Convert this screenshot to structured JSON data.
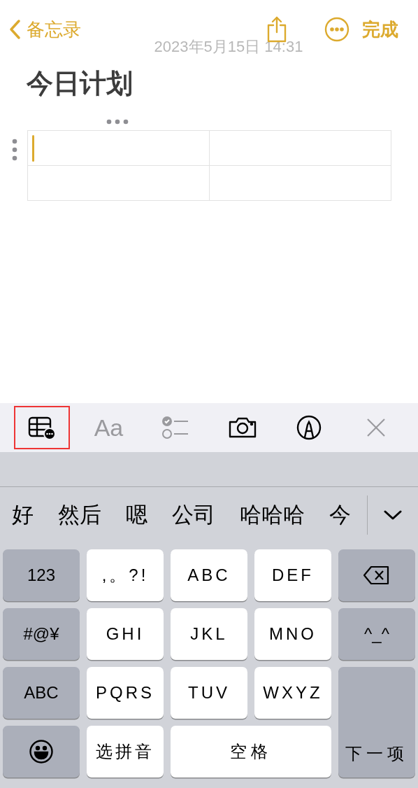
{
  "nav": {
    "back_label": "备忘录",
    "done_label": "完成"
  },
  "note": {
    "date": "2023年5月15日 14:31",
    "title": "今日计划",
    "table": {
      "rows": [
        [
          {
            "focused": true
          },
          {
            "focused": false
          }
        ],
        [
          {
            "focused": false
          },
          {
            "focused": false
          }
        ]
      ]
    }
  },
  "toolbar": [
    {
      "kind": "table",
      "disabled": false,
      "highlighted": true
    },
    {
      "kind": "format",
      "label": "Aa",
      "disabled": true,
      "highlighted": false
    },
    {
      "kind": "checklist",
      "disabled": true,
      "highlighted": false
    },
    {
      "kind": "camera",
      "disabled": false,
      "highlighted": false
    },
    {
      "kind": "markup",
      "disabled": false,
      "highlighted": false
    },
    {
      "kind": "close",
      "disabled": true,
      "highlighted": false
    }
  ],
  "candidates": [
    "好",
    "然后",
    "嗯",
    "公司",
    "哈哈哈",
    "今"
  ],
  "keys": [
    {
      "kind": "function",
      "label": "123"
    },
    {
      "kind": "letter",
      "label": ",。?!"
    },
    {
      "kind": "letter",
      "label": "ABC"
    },
    {
      "kind": "letter",
      "label": "DEF"
    },
    {
      "kind": "delete"
    },
    {
      "kind": "function",
      "label": "#@¥"
    },
    {
      "kind": "letter",
      "label": "GHI"
    },
    {
      "kind": "letter",
      "label": "JKL"
    },
    {
      "kind": "letter",
      "label": "MNO"
    },
    {
      "kind": "function",
      "label": "^_^"
    },
    {
      "kind": "function",
      "label": "ABC"
    },
    {
      "kind": "letter",
      "label": "PQRS"
    },
    {
      "kind": "letter",
      "label": "TUV"
    },
    {
      "kind": "letter",
      "label": "WXYZ"
    },
    {
      "kind": "emoji"
    },
    {
      "kind": "letter",
      "label": "选拼音"
    },
    {
      "kind": "space",
      "label": "空格"
    },
    {
      "kind": "return",
      "label": "下一项"
    }
  ]
}
